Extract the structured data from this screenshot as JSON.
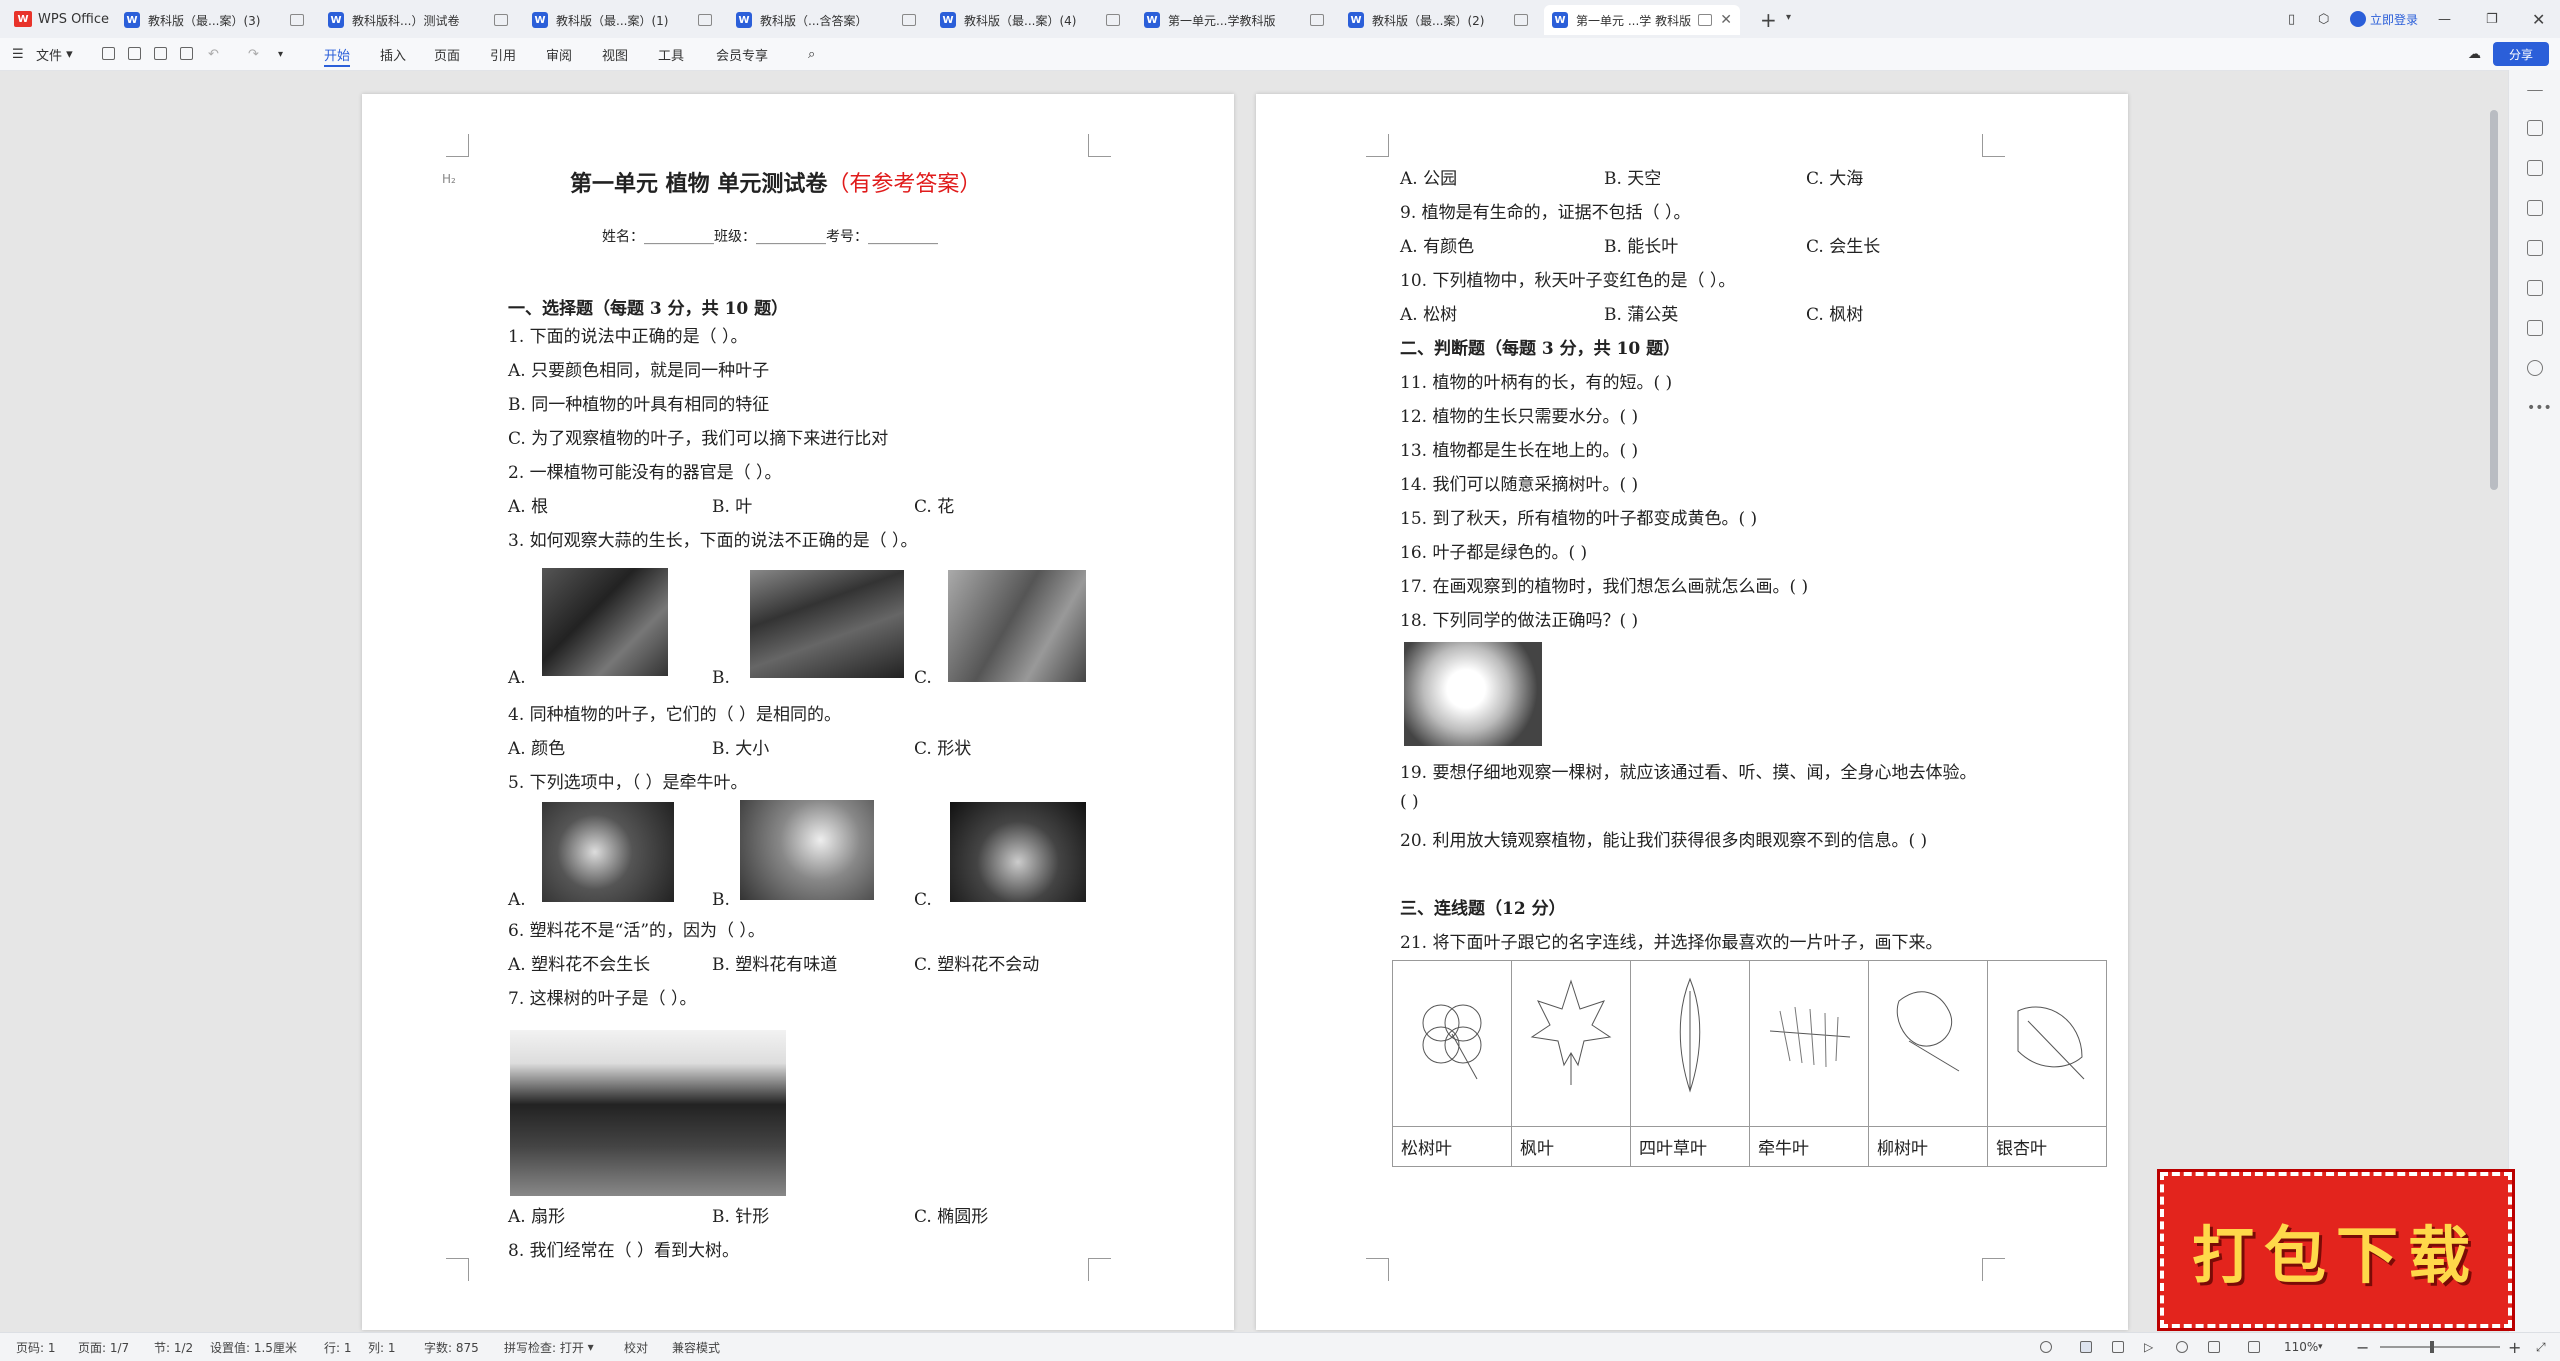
{
  "app": {
    "name": "WPS Office",
    "login": "立即登录"
  },
  "tabs": [
    {
      "label": "教科版（最...案）(3)"
    },
    {
      "label": "教科版科...）测试卷"
    },
    {
      "label": "教科版（最...案）(1)"
    },
    {
      "label": "教科版（...含答案）"
    },
    {
      "label": "教科版（最...案）(4)"
    },
    {
      "label": "第一单元...学教科版"
    },
    {
      "label": "教科版（最...案）(2)"
    },
    {
      "label": "第一单元 ...学 教科版",
      "active": true
    }
  ],
  "menu": {
    "file": "文件",
    "items": [
      "开始",
      "插入",
      "页面",
      "引用",
      "审阅",
      "视图",
      "工具",
      "会员专享"
    ],
    "active": "开始",
    "share": "分享"
  },
  "page1": {
    "heading_marker": "H₂",
    "title": "第一单元  植物  单元测试卷",
    "title_suffix": "（有参考答案）",
    "info": "姓名：__________班级：__________考号：__________",
    "sec1": "一、选择题（每题 3 分，共 10 题）",
    "lines": [
      "1.  下面的说法中正确的是（    ）。",
      "A.  只要颜色相同，就是同一种叶子",
      "B.  同一种植物的叶具有相同的特征",
      "C.  为了观察植物的叶子，我们可以摘下来进行比对",
      "2.  一棵植物可能没有的器官是（    ）。"
    ],
    "q2_opts": [
      "A.  根",
      "B.  叶",
      "C.  花"
    ],
    "q3": "3.  如何观察大蒜的生长，下面的说法不正确的是（    ）。",
    "q3_opts": [
      "A.",
      "B.",
      "C."
    ],
    "q4": "4.  同种植物的叶子，它们的（    ）是相同的。",
    "q4_opts": [
      "A.  颜色",
      "B.  大小",
      "C.  形状"
    ],
    "q5": "5.  下列选项中，（    ）是牵牛叶。",
    "q5_opts": [
      "A.",
      "B.",
      "C."
    ],
    "q6": "6.  塑料花不是“活”的，因为（    ）。",
    "q6_opts": [
      "A.  塑料花不会生长",
      "B.  塑料花有味道",
      "C.  塑料花不会动"
    ],
    "q7": "7.  这棵树的叶子是（    ）。",
    "q7_opts": [
      "A.  扇形",
      "B.  针形",
      "C.  椭圆形"
    ],
    "q8": "8.  我们经常在（    ）看到大树。"
  },
  "page2": {
    "q8_opts": [
      "A.  公园",
      "B.  天空",
      "C.  大海"
    ],
    "q9": "9.  植物是有生命的，证据不包括（    ）。",
    "q9_opts": [
      "A.  有颜色",
      "B.  能长叶",
      "C.  会生长"
    ],
    "q10": "10.  下列植物中，秋天叶子变红色的是（    ）。",
    "q10_opts": [
      "A.  松树",
      "B.  蒲公英",
      "C.  枫树"
    ],
    "sec2": "二、判断题（每题 3 分，共 10 题）",
    "judge": [
      "11.  植物的叶柄有的长，有的短。(          )",
      "12.  植物的生长只需要水分。(          )",
      "13.  植物都是生长在地上的。(          )",
      "14.  我们可以随意采摘树叶。(          )",
      "15.  到了秋天，所有植物的叶子都变成黄色。(          )",
      "16.  叶子都是绿色的。(          )",
      "17.  在画观察到的植物时，我们想怎么画就怎么画。(          )",
      "18.  下列同学的做法正确吗？(          )"
    ],
    "q19": "19.  要想仔细地观察一棵树，就应该通过看、听、摸、闻，全身心地去体验。",
    "q19_paren": "(          )",
    "q20": "20.  利用放大镜观察植物，能让我们获得很多肉眼观察不到的信息。(          )",
    "sec3": "三、连线题（12 分）",
    "q21": "21.  将下面叶子跟它的名字连线，并选择你最喜欢的一片叶子，画下来。",
    "leaf_names": [
      "松树叶",
      "枫叶",
      "四叶草叶",
      "牵牛叶",
      "柳树叶",
      "银杏叶"
    ]
  },
  "status": {
    "page": "页码: 1",
    "pages": "页面: 1/7",
    "section": "节: 1/2",
    "setting": "设置值: 1.5厘米",
    "row": "行: 1",
    "col": "列: 1",
    "words": "字数: 875",
    "spell": "拼写检查: 打开",
    "proof": "校对",
    "compat": "兼容模式",
    "zoom": "110%"
  },
  "banner": "打包下载"
}
